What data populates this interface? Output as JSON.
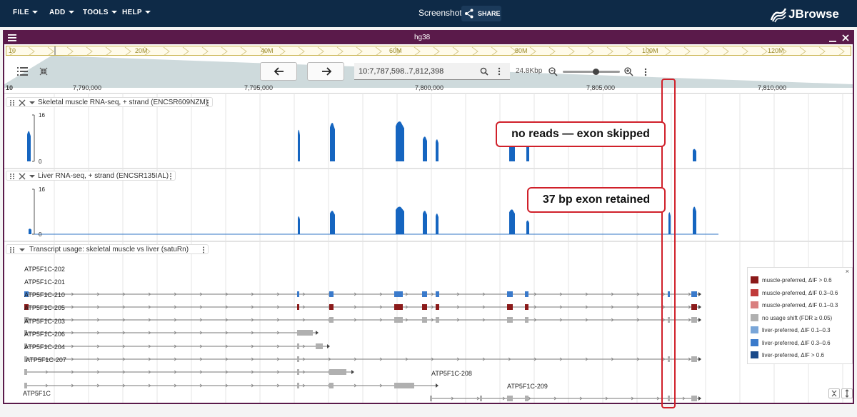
{
  "menus": [
    "FILE",
    "ADD",
    "TOOLS",
    "HELP"
  ],
  "session_title": "Screenshot",
  "share_label": "SHARE",
  "logo_text": "JBrowse",
  "view": {
    "name": "hg38",
    "overview_chr": "10",
    "overview_ticks": [
      "20M",
      "40M",
      "60M",
      "80M",
      "100M",
      "120M"
    ],
    "location": "10:7,787,598..7,812,398",
    "span": "24.8Kbp",
    "scale_chr": "10",
    "scale_ticks": [
      "7,790,000",
      "7,795,000",
      "7,800,000",
      "7,805,000",
      "7,810,000"
    ]
  },
  "tracks": {
    "muscle": {
      "name": "Skeletal muscle RNA-seq, + strand (ENCSR609NZM)",
      "ymax": "16",
      "ymin": "0"
    },
    "liver": {
      "name": "Liver RNA-seq, + strand (ENCSR135IAL)",
      "ymax": "16",
      "ymin": "0"
    },
    "usage": {
      "name": "Transcript usage: skeletal muscle vs liver (satuRn)",
      "gene": "ATP5F1C"
    }
  },
  "transcripts": [
    "ATP5F1C-202",
    "ATP5F1C-201",
    "ATP5F1C-210",
    "ATP5F1C-205",
    "ATP5F1C-203",
    "ATP5F1C-206",
    "ATP5F1C-204",
    "ATP5F1C-207",
    "ATP5F1C-208",
    "ATP5F1C-209"
  ],
  "legend": [
    {
      "label": "muscle-preferred, ΔIF > 0.6",
      "color": "#8b1a1a"
    },
    {
      "label": "muscle-preferred, ΔIF 0.3–0.6",
      "color": "#c03a3a"
    },
    {
      "label": "muscle-preferred, ΔIF 0.1–0.3",
      "color": "#d98080"
    },
    {
      "label": "no usage shift (FDR ≥ 0.05)",
      "color": "#b0b0b0"
    },
    {
      "label": "liver-preferred, ΔIF 0.1–0.3",
      "color": "#7aa6d8"
    },
    {
      "label": "liver-preferred, ΔIF 0.3–0.6",
      "color": "#3a7acb"
    },
    {
      "label": "liver-preferred, ΔIF > 0.6",
      "color": "#1a4a8a"
    }
  ],
  "legend_close": "×",
  "annotations": {
    "skip": "no reads — exon skipped",
    "retain": "37 bp exon retained"
  },
  "colors": {
    "coverage": "#1565c0",
    "topbar": "#0e2a47",
    "view_header": "#5a1a4a",
    "annotation": "#d0202a"
  }
}
